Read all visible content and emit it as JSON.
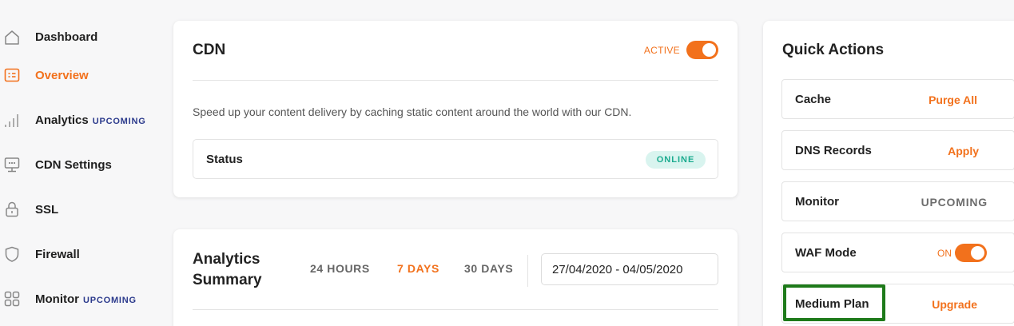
{
  "sidebar": {
    "items": [
      {
        "label": "Dashboard",
        "badge": "",
        "icon": "home-icon"
      },
      {
        "label": "Overview",
        "badge": "",
        "icon": "overview-icon",
        "active": true
      },
      {
        "label": "Analytics",
        "badge": "UPCOMING",
        "icon": "bar-chart-icon"
      },
      {
        "label": "CDN Settings",
        "badge": "",
        "icon": "cdn-settings-icon"
      },
      {
        "label": "SSL",
        "badge": "",
        "icon": "lock-icon"
      },
      {
        "label": "Firewall",
        "badge": "",
        "icon": "shield-icon"
      },
      {
        "label": "Monitor",
        "badge": "UPCOMING",
        "icon": "grid-icon"
      }
    ]
  },
  "cdn": {
    "title": "CDN",
    "active_label": "ACTIVE",
    "active": true,
    "description": "Speed up your content delivery by caching static content around the world with our CDN.",
    "status_label": "Status",
    "status_value": "ONLINE"
  },
  "analytics": {
    "title_line1": "Analytics",
    "title_line2": "Summary",
    "ranges": [
      "24 HOURS",
      "7 DAYS",
      "30 DAYS"
    ],
    "selected_range": "7 DAYS",
    "date_range": "27/04/2020 - 04/05/2020"
  },
  "quick_actions": {
    "title": "Quick Actions",
    "rows": [
      {
        "label": "Cache",
        "action": "Purge All"
      },
      {
        "label": "DNS Records",
        "action": "Apply"
      },
      {
        "label": "Monitor",
        "action": "UPCOMING"
      },
      {
        "label": "WAF Mode",
        "toggle_label": "ON",
        "toggle_on": true
      },
      {
        "label": "Medium Plan",
        "action": "Upgrade"
      }
    ]
  },
  "colors": {
    "accent": "#f2711c",
    "badge_navy": "#2b3a8c",
    "online_green": "#1bab8f",
    "highlight": "#1e7a1a"
  }
}
